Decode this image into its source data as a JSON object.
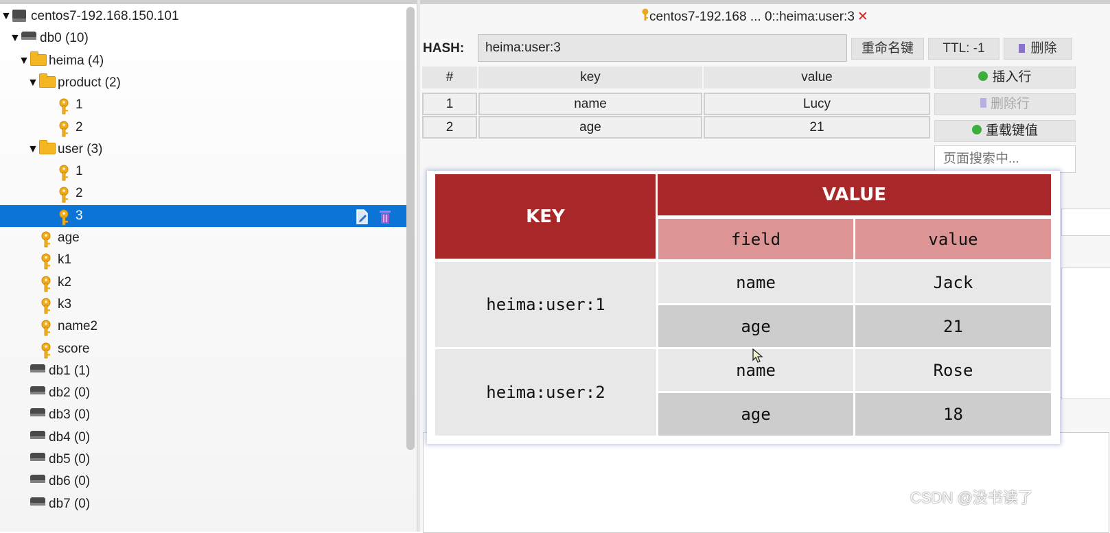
{
  "tree": {
    "rows": [
      {
        "label": "centos7-192.168.150.101",
        "type": "server",
        "depth": 0,
        "expanded": true
      },
      {
        "label": "db0  (10)",
        "type": "db",
        "depth": 1,
        "expanded": true
      },
      {
        "label": "heima (4)",
        "type": "folder",
        "depth": 2,
        "expanded": true
      },
      {
        "label": "product (2)",
        "type": "folder",
        "depth": 3,
        "expanded": true
      },
      {
        "label": "1",
        "type": "key",
        "depth": 5
      },
      {
        "label": "2",
        "type": "key",
        "depth": 5
      },
      {
        "label": "user (3)",
        "type": "folder",
        "depth": 3,
        "expanded": true
      },
      {
        "label": "1",
        "type": "key",
        "depth": 5
      },
      {
        "label": "2",
        "type": "key",
        "depth": 5
      },
      {
        "label": "3",
        "type": "key",
        "depth": 5,
        "selected": true
      },
      {
        "label": "age",
        "type": "key",
        "depth": 3
      },
      {
        "label": "k1",
        "type": "key",
        "depth": 3
      },
      {
        "label": "k2",
        "type": "key",
        "depth": 3
      },
      {
        "label": "k3",
        "type": "key",
        "depth": 3
      },
      {
        "label": "name2",
        "type": "key",
        "depth": 3
      },
      {
        "label": "score",
        "type": "key",
        "depth": 3
      },
      {
        "label": "db1  (1)",
        "type": "db",
        "depth": 2
      },
      {
        "label": "db2  (0)",
        "type": "db",
        "depth": 2
      },
      {
        "label": "db3  (0)",
        "type": "db",
        "depth": 2
      },
      {
        "label": "db4  (0)",
        "type": "db",
        "depth": 2
      },
      {
        "label": "db5  (0)",
        "type": "db",
        "depth": 2
      },
      {
        "label": "db6  (0)",
        "type": "db",
        "depth": 2
      },
      {
        "label": "db7  (0)",
        "type": "db",
        "depth": 2
      }
    ]
  },
  "tab": {
    "title": "centos7-192.168 ... 0::heima:user:3",
    "close": "✕"
  },
  "editor": {
    "type_label": "HASH:",
    "key_name": "heima:user:3",
    "rename_label": "重命名键",
    "ttl_label": "TTL:  -1",
    "delete_label": "删除"
  },
  "grid": {
    "columns": [
      "#",
      "key",
      "value"
    ],
    "rows": [
      {
        "num": "1",
        "key": "name",
        "value": "Lucy"
      },
      {
        "num": "2",
        "key": "age",
        "value": "21"
      }
    ]
  },
  "side_buttons": {
    "insert_row": "插入行",
    "delete_row": "删除行",
    "reload": "重载键值",
    "search_placeholder": "页面搜索中..."
  },
  "overlay": {
    "key_header": "KEY",
    "value_header": "VALUE",
    "field_header": "field",
    "val_sub_header": "value",
    "entries": [
      {
        "key": "heima:user:1",
        "fields": [
          {
            "field": "name",
            "value": "Jack"
          },
          {
            "field": "age",
            "value": "21"
          }
        ]
      },
      {
        "key": "heima:user:2",
        "fields": [
          {
            "field": "name",
            "value": "Rose"
          },
          {
            "field": "age",
            "value": "18"
          }
        ]
      }
    ]
  },
  "watermark": "CSDN @没书读了",
  "colors": {
    "selection": "#0b74d6",
    "overlay_header": "#a8282a",
    "overlay_subheader": "#dd9494",
    "insert_icon": "#3cae3c",
    "delete_icon": "#8a73c8"
  }
}
